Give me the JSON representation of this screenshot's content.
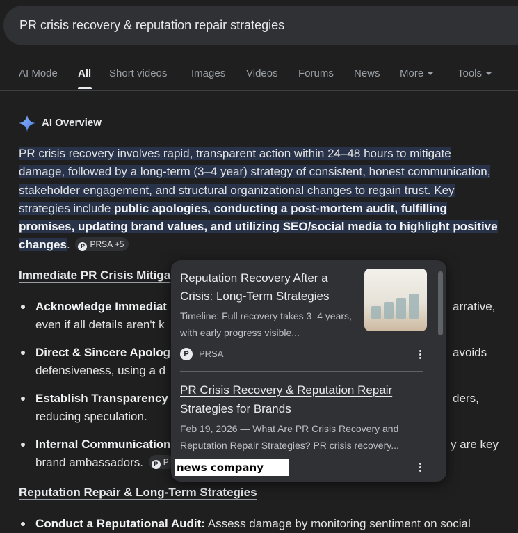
{
  "search": {
    "query": "PR crisis recovery & reputation repair strategies"
  },
  "tabs": [
    {
      "label": "AI Mode"
    },
    {
      "label": "All"
    },
    {
      "label": "Short videos"
    },
    {
      "label": "Images"
    },
    {
      "label": "Videos"
    },
    {
      "label": "Forums"
    },
    {
      "label": "News"
    },
    {
      "label": "More"
    },
    {
      "label": "Tools"
    }
  ],
  "overview": {
    "title": "AI Overview",
    "intro_plain": "PR crisis recovery involves rapid, transparent action within 24–48 hours to mitigate damage, followed by a long-term (3–4 year) strategy of consistent, honest communication, stakeholder engagement, and structural organizational changes to regain trust. Key strategies include ",
    "intro_bold": "public apologies, conducting a post-mortem audit, fulfilling promises, updating brand values, and utilizing SEO/social media to highlight positive changes",
    "intro_end": ".",
    "chip": "PRSA +5"
  },
  "section1": {
    "heading": "Immediate PR Crisis Mitiga",
    "items": [
      {
        "bold": "Acknowledge Immediat",
        "line2": "even if all details aren't k",
        "right1": "arrative,"
      },
      {
        "bold": "Direct & Sincere Apolog",
        "line2": "defensiveness, using a d",
        "right1": "avoids"
      },
      {
        "bold": "Establish Transparency",
        "line2": "reducing speculation.",
        "right1": "ders,"
      },
      {
        "bold": "Internal Communication",
        "line2": "brand ambassadors.",
        "right1": "y are key",
        "chip": "P"
      }
    ]
  },
  "section2": {
    "heading": "Reputation Repair & Long-Term Strategies",
    "items": [
      {
        "bold": "Conduct a Reputational Audit:",
        "rest": " Assess damage by monitoring sentiment on social"
      }
    ]
  },
  "popup": {
    "card1": {
      "title": "Reputation Recovery After a Crisis: Long-Term Strategies",
      "snippet": "Timeline: Full recovery takes 3–4 years, with early progress visible...",
      "source": "PRSA",
      "source_logo": "P"
    },
    "card2": {
      "title": "PR Crisis Recovery & Reputation Repair Strategies for Brands",
      "snippet": "Feb 19, 2026 — What Are PR Crisis Recovery and Reputation Repair Strategies? PR crisis recovery...",
      "source": "news company"
    }
  }
}
